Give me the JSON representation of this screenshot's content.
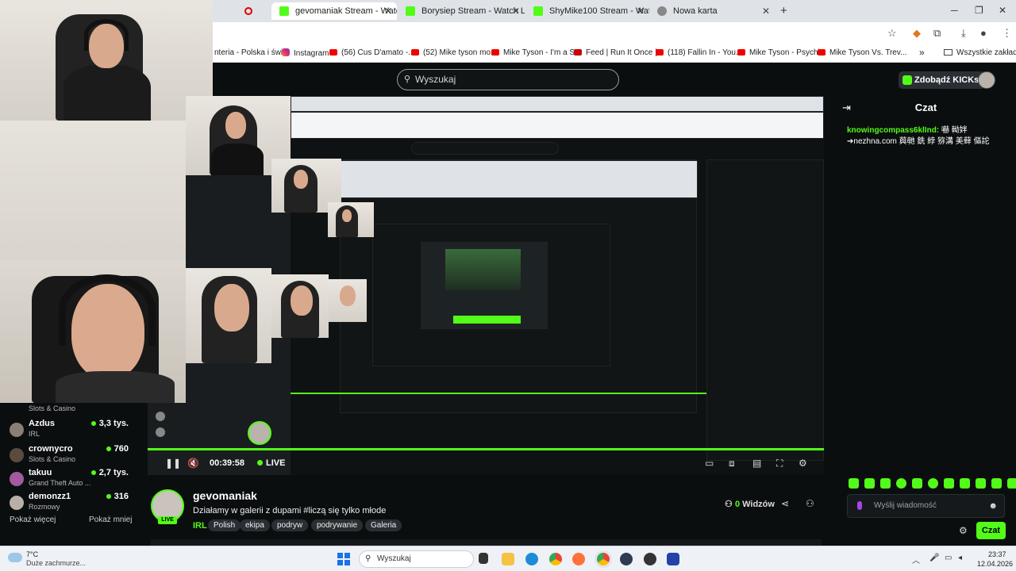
{
  "tabs": [
    {
      "title": "gevomaniak Stream - Watch Li",
      "active": true
    },
    {
      "title": "Borysiep Stream - Watch Live o",
      "active": false
    },
    {
      "title": "ShyMike100 Stream - Watch Li",
      "active": false
    },
    {
      "title": "Nowa karta",
      "active": false
    }
  ],
  "new_tab": "+",
  "bookmarks": [
    "nteria - Polska i świ...",
    "Instagram",
    "(56) Cus D'amato -...",
    "(52) Mike tyson mo...",
    "Mike Tyson - I'm a S...",
    "Feed | Run It Once |...",
    "(118) Fallin In - You...",
    "Mike Tyson - Psychi...",
    "Mike Tyson Vs. Trev..."
  ],
  "bookmarks_more": "»",
  "all_bookmarks": "Wszystkie zakładki",
  "header": {
    "search_placeholder": "Wyszukaj",
    "kicks_button": "Zdobądź KICKs"
  },
  "player": {
    "time": "00:39:58",
    "live": "LIVE"
  },
  "sidebar": {
    "top_category": "Slots & Casino",
    "items": [
      {
        "name": "Azdus",
        "category": "IRL",
        "viewers": "3,3 tys."
      },
      {
        "name": "crownycro",
        "category": "Slots & Casino",
        "viewers": "760"
      },
      {
        "name": "takuu",
        "category": "Grand Theft Auto ...",
        "viewers": "2,7 tys."
      },
      {
        "name": "demonzz1",
        "category": "Rozmowy",
        "viewers": "316"
      }
    ],
    "show_more": "Pokaż więcej",
    "show_less": "Pokaż mniej"
  },
  "channel": {
    "name": "gevomaniak",
    "live_badge": "LIVE",
    "title": "Działamy w galerii z dupami #liczą się tylko młode",
    "category": "IRL",
    "tags": [
      "Polish",
      "ekipa",
      "podryw",
      "podrywanie",
      "Galeria"
    ],
    "viewers_count": "0",
    "viewers_label": "Widzów"
  },
  "chat": {
    "title": "Czat",
    "message_user": "knowingcompass6klInd:",
    "message_text": "嚇 軪姅 ➔nezhna.com 藇毑 銑 綍 猕溝 美藓 傴詑",
    "input_placeholder": "Wyślij wiadomość",
    "send_button": "Czat"
  },
  "taskbar": {
    "temperature": "7°C",
    "weather": "Duże zachmurze...",
    "search": "Wyszukaj",
    "time": "23:37",
    "date": "12.04.2026"
  },
  "colors": {
    "kick_green": "#53fc18",
    "background": "#0b0e0f"
  }
}
